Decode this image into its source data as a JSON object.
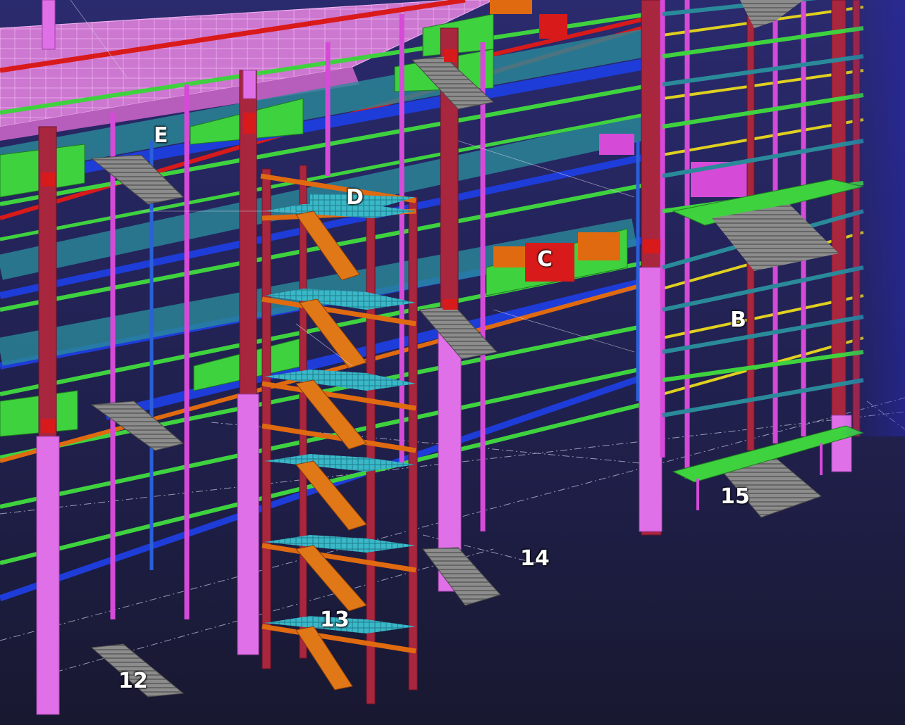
{
  "scene": {
    "description_free": true,
    "colors": {
      "background": "#24245a",
      "column_maroon": "#a8263e",
      "column_magenta": "#d64ad8",
      "column_violet": "#e070e8",
      "beam_green": "#3fd23f",
      "beam_blue": "#1e3cd8",
      "beam_red": "#d81a1a",
      "beam_teal": "#2a8a9a",
      "beam_orange": "#e06a10",
      "beam_yellow": "#e0d020",
      "stair_grey": "#8a8a8a",
      "grating_cyan": "#3ab8c8",
      "deck_pink": "#d07ad0"
    }
  },
  "labels": {
    "E": "E",
    "D": "D",
    "C": "C",
    "B": "B",
    "n12": "12",
    "n13": "13",
    "n14": "14",
    "n15": "15"
  }
}
